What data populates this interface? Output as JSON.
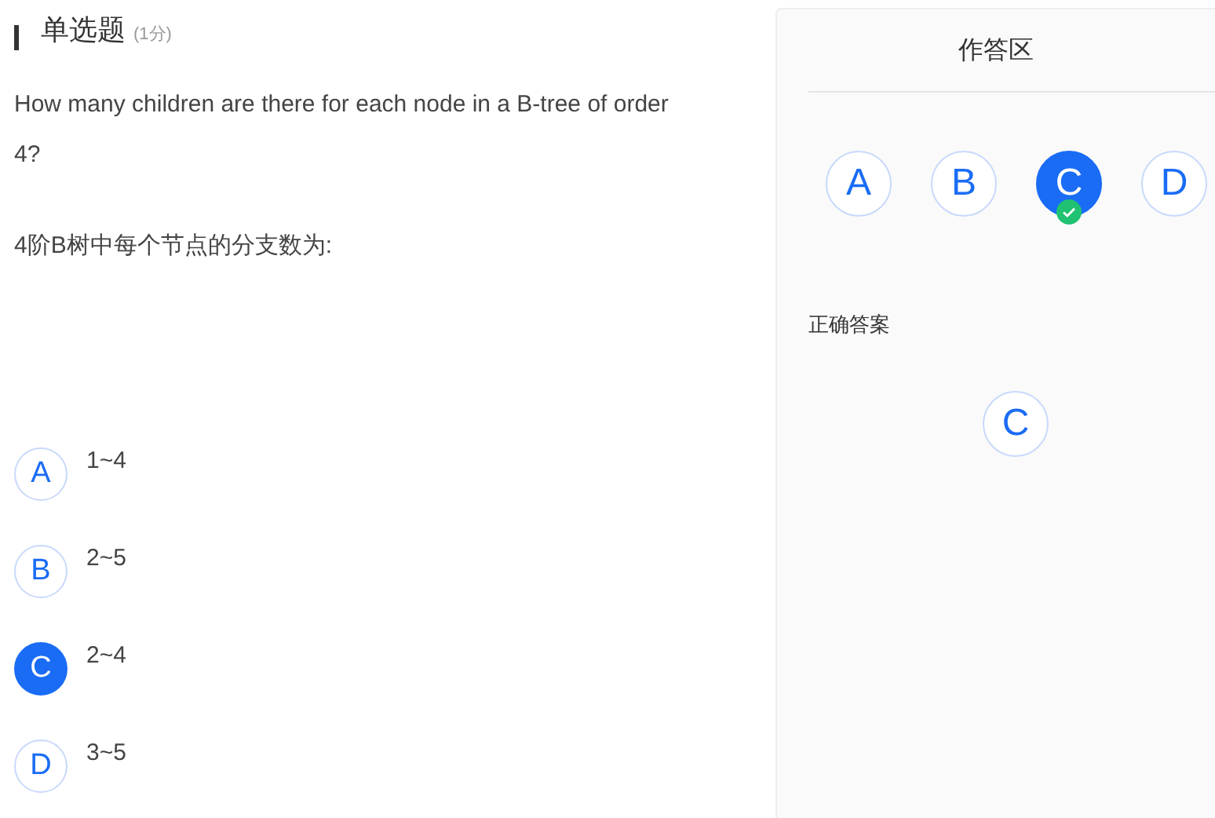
{
  "question": {
    "type": "单选题",
    "score": "(1分)",
    "paragraphs": [
      "How many children are there for each node in a B-tree of order 4?",
      "4阶B树中每个节点的分支数为:"
    ],
    "options": [
      {
        "letter": "A",
        "text": "1~4",
        "selected": false
      },
      {
        "letter": "B",
        "text": "2~5",
        "selected": false
      },
      {
        "letter": "C",
        "text": "2~4",
        "selected": true
      },
      {
        "letter": "D",
        "text": "3~5",
        "selected": false
      }
    ]
  },
  "answer_panel": {
    "title": "作答区",
    "choices": [
      {
        "letter": "A",
        "selected": false,
        "correct": false
      },
      {
        "letter": "B",
        "selected": false,
        "correct": false
      },
      {
        "letter": "C",
        "selected": true,
        "correct": true
      },
      {
        "letter": "D",
        "selected": false,
        "correct": false
      }
    ],
    "correct_label": "正确答案",
    "correct_answer": "C"
  }
}
